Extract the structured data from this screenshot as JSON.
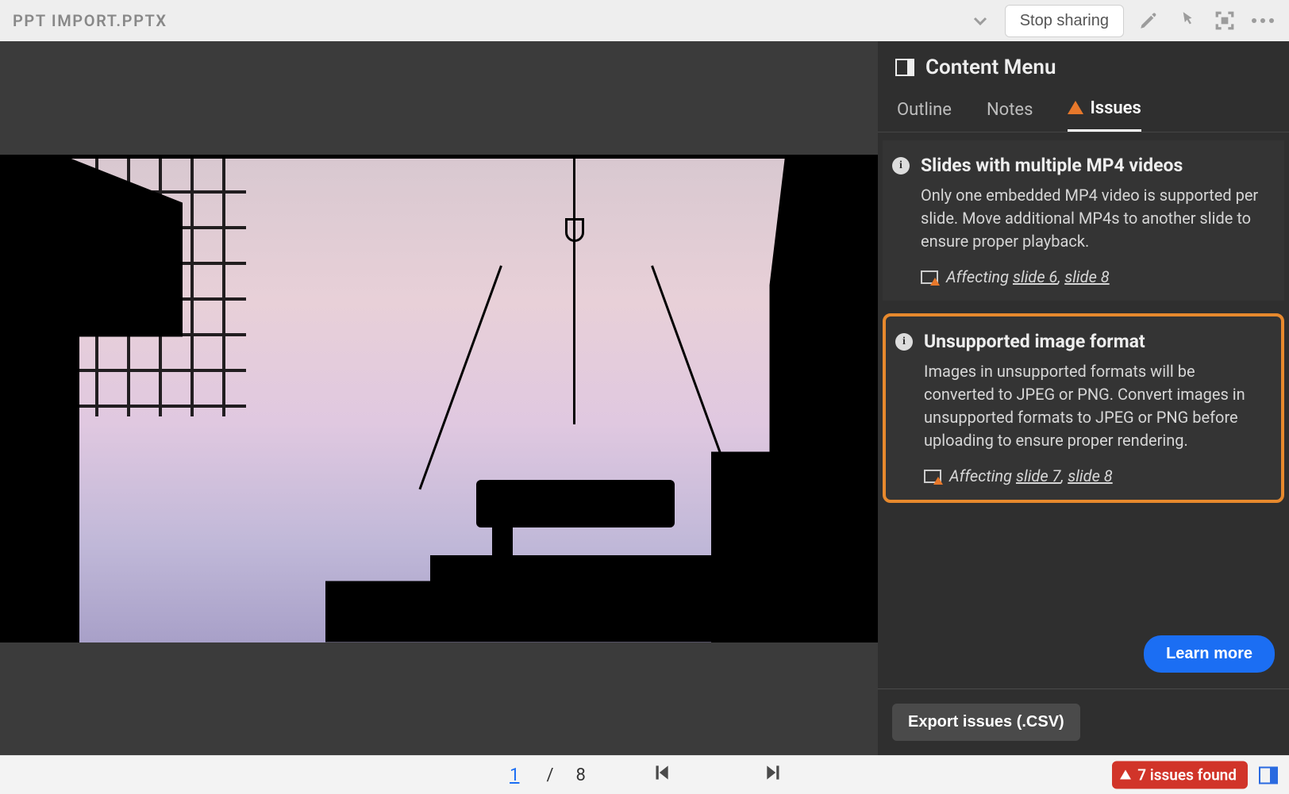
{
  "toolbar": {
    "title": "PPT IMPORT.PPTX",
    "stop_sharing": "Stop sharing"
  },
  "panel": {
    "title": "Content Menu",
    "tabs": {
      "outline": "Outline",
      "notes": "Notes",
      "issues": "Issues"
    },
    "issues": [
      {
        "title": "Slides with multiple MP4 videos",
        "body": "Only one embedded MP4 video is supported per slide. Move additional MP4s to another slide to ensure proper playback.",
        "affect_prefix": "Affecting",
        "slides": [
          "slide 6",
          "slide 8"
        ],
        "highlight": false
      },
      {
        "title": "Unsupported image format",
        "body": "Images in unsupported formats will be converted to JPEG or PNG. Convert images in unsupported formats to JPEG or PNG before uploading to ensure proper rendering.",
        "affect_prefix": "Affecting",
        "slides": [
          "slide 7",
          "slide 8"
        ],
        "highlight": true
      }
    ],
    "learn_more": "Learn more",
    "export": "Export issues (.CSV)"
  },
  "pager": {
    "current": "1",
    "sep": "/",
    "total": "8"
  },
  "status": {
    "badge": "7 issues found"
  }
}
